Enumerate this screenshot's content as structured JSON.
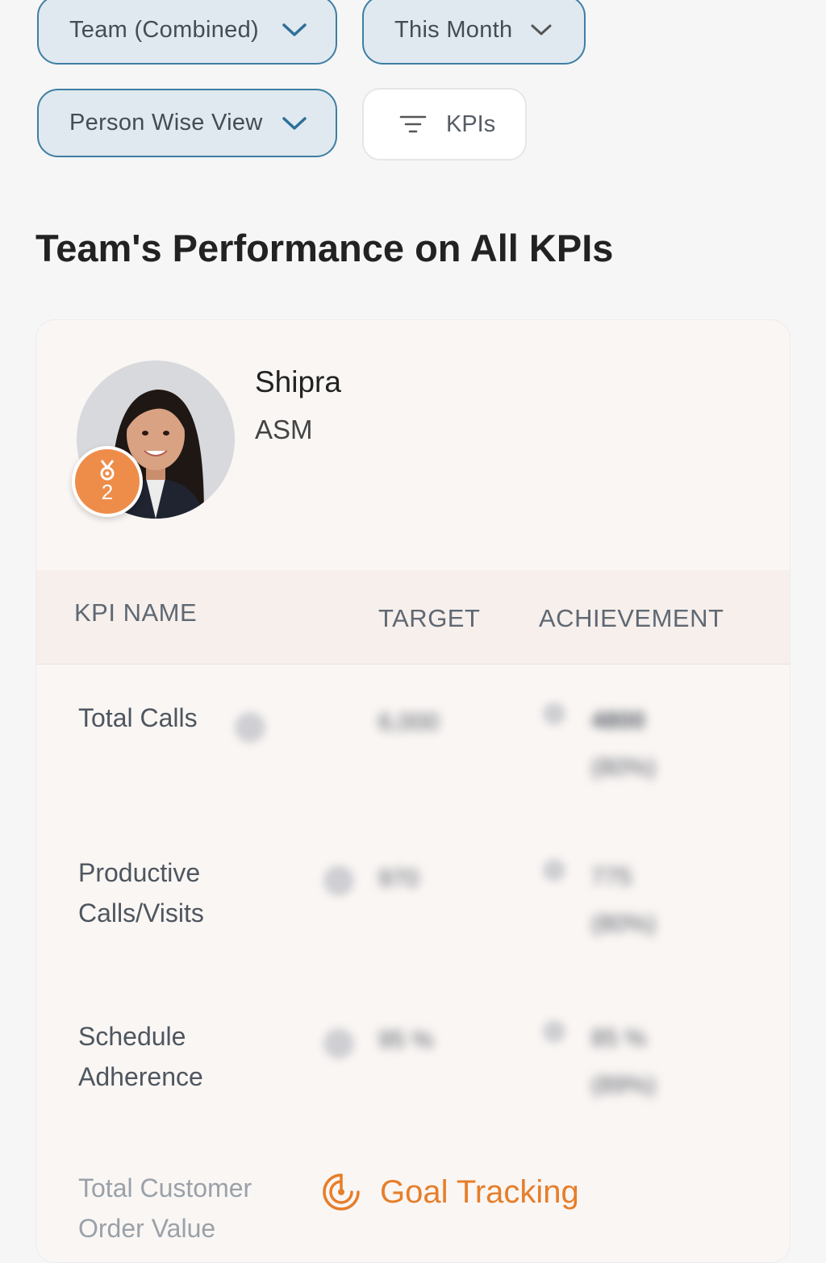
{
  "filters": {
    "team": "Team (Combined)",
    "period": "This Month",
    "view": "Person Wise View",
    "kpis_button": "KPIs"
  },
  "page_title": "Team's Performance on All KPIs",
  "person": {
    "name": "Shipra",
    "role": "ASM",
    "rank": "2"
  },
  "table": {
    "headers": {
      "kpi_name": "KPI NAME",
      "target": "TARGET",
      "achievement": "ACHIEVEMENT"
    },
    "rows": [
      {
        "kpi": "Total Calls",
        "target": "6,000",
        "achievement": "4800",
        "achievement_pct": "(80%)"
      },
      {
        "kpi": "Productive Calls/Visits",
        "target": "970",
        "achievement": "775",
        "achievement_pct": "(80%)"
      },
      {
        "kpi": "Schedule Adherence",
        "target": "95 %",
        "achievement": "85 %",
        "achievement_pct": "(89%)"
      },
      {
        "kpi": "Total Customer Order Value"
      }
    ]
  },
  "overlay": {
    "goal_tracking": "Goal Tracking"
  },
  "colors": {
    "accent": "#3f7ea3",
    "badge": "#ee8d4a",
    "goal": "#e67e2a"
  }
}
